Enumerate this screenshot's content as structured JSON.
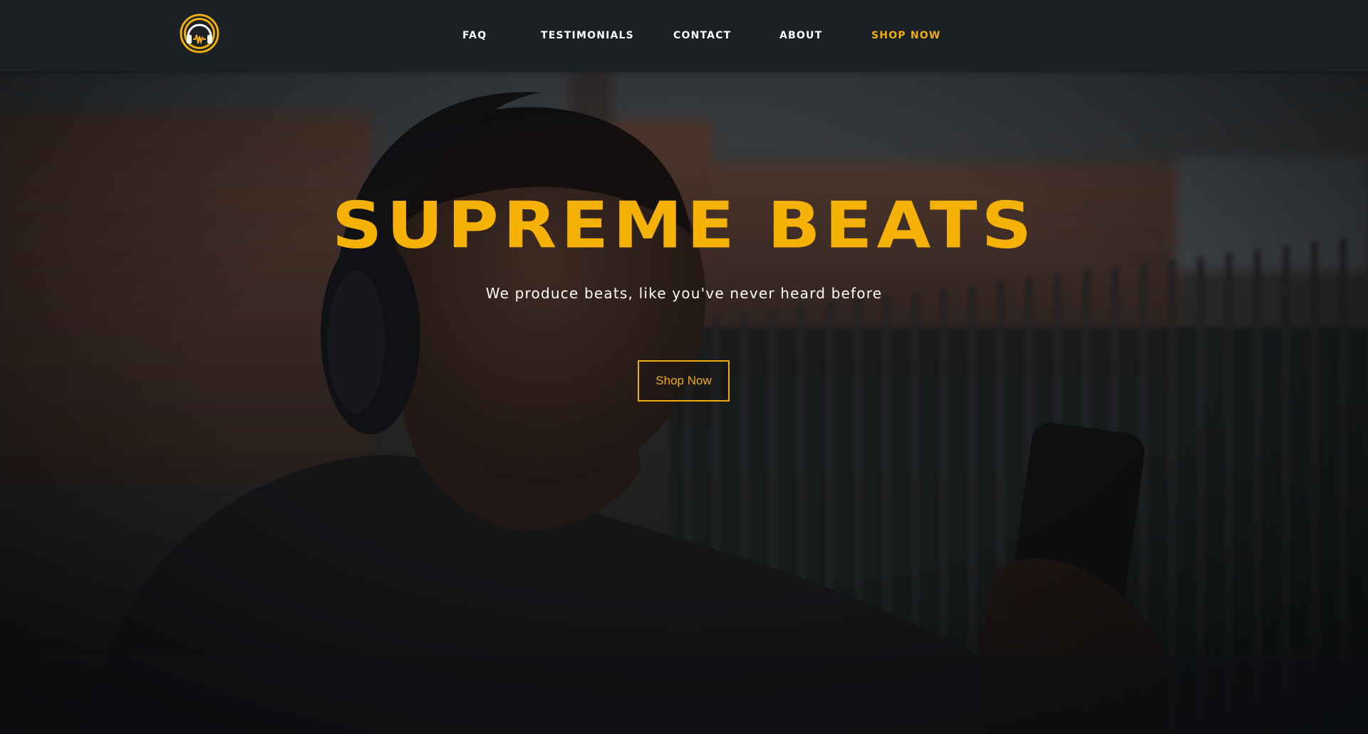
{
  "brand": {
    "logo_icon": "headphones-logo-icon",
    "accent_color": "#f5b106"
  },
  "nav": {
    "items": [
      {
        "label": "FAQ"
      },
      {
        "label": "TESTIMONIALS"
      },
      {
        "label": "CONTACT"
      },
      {
        "label": "ABOUT"
      },
      {
        "label": "SHOP NOW"
      }
    ]
  },
  "hero": {
    "title": "SUPREME BEATS",
    "subtitle": "We produce beats, like you've never heard before",
    "cta_label": "Shop Now",
    "background_image": "person-wearing-headphones-photo"
  }
}
